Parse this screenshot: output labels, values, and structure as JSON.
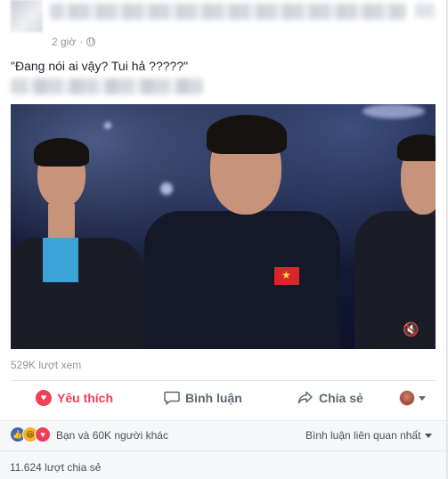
{
  "post": {
    "time": "2 giờ",
    "privacy_icon": "globe-icon",
    "text": "\"Đang nói ai vậy? Tui hả ?????\""
  },
  "video": {
    "views": "529K lượt xem",
    "mute_icon": "speaker-muted-icon"
  },
  "actions": {
    "like_label": "Yêu thích",
    "comment_label": "Bình luận",
    "share_label": "Chia sẻ",
    "like_icon": "heart-icon",
    "comment_icon": "comment-icon",
    "share_icon": "share-icon"
  },
  "reactions": {
    "summary": "Bạn và 60K người khác",
    "sort_label": "Bình luận liên quan nhất",
    "icons": [
      "like-icon",
      "haha-icon",
      "love-icon"
    ]
  },
  "shares": {
    "count_text": "11.624 lượt chia sẻ"
  },
  "colors": {
    "like_red": "#f33e58",
    "fb_blue": "#4267b2",
    "meta_gray": "#90949c"
  }
}
